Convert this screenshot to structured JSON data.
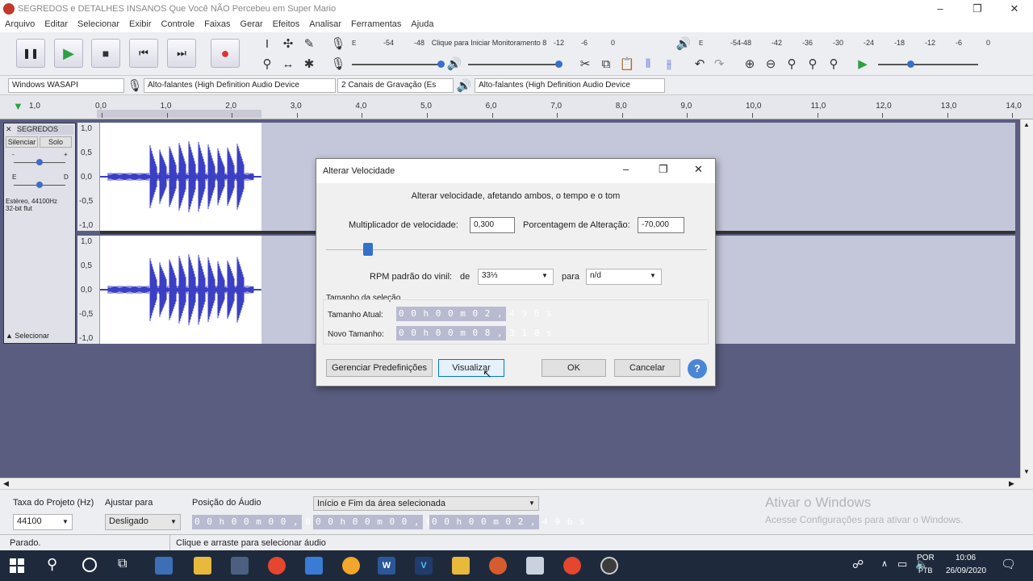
{
  "window": {
    "title": "SEGREDOS e DETALHES INSANOS Que Você NÃO Percebeu em Super Mario",
    "minimize": "–",
    "maximize": "❐",
    "close": "✕"
  },
  "menu": [
    "Arquivo",
    "Editar",
    "Selecionar",
    "Exibir",
    "Controle",
    "Faixas",
    "Gerar",
    "Efeitos",
    "Analisar",
    "Ferramentas",
    "Ajuda"
  ],
  "transport": {
    "pause": "❚❚",
    "play": "▶",
    "stop": "■",
    "skip_start": "⏮",
    "skip_end": "⏭",
    "record": "●"
  },
  "meter": {
    "record_scale": [
      "-54",
      "-48",
      "Clique para Iniciar Monitoramento 8",
      "-12",
      "-6",
      "0"
    ],
    "play_scale": [
      "-54",
      "-48",
      "-42",
      "-36",
      "-30",
      "-24",
      "-18",
      "-12",
      "-6",
      "0"
    ],
    "left_channel": "E",
    "right_channel": "D"
  },
  "devices": {
    "host": "Windows WASAPI",
    "recording_device": "Alto-falantes (High Definition Audio Device",
    "channels": "2 Canais de Gravação (Es",
    "playback_device": "Alto-falantes (High Definition Audio Device"
  },
  "timeline": {
    "ticks": [
      "0,0",
      "1,0",
      "2,0",
      "3,0",
      "4,0",
      "5,0",
      "6,0",
      "7,0",
      "8,0",
      "9,0",
      "10,0",
      "11,0",
      "12,0",
      "13,0",
      "14,0"
    ],
    "start_label": "1,0"
  },
  "track": {
    "name": "SEGREDOS",
    "mute": "Silenciar",
    "solo": "Solo",
    "gain_minus": "-",
    "gain_plus": "+",
    "pan_left": "E",
    "pan_right": "D",
    "info": "Estéreo, 44100Hz\n32-bit flut",
    "select": "Selecionar",
    "scale": [
      "1,0",
      "0,5",
      "0,0",
      "-0,5",
      "-1,0"
    ]
  },
  "dialog": {
    "title": "Alterar Velocidade",
    "description": "Alterar velocidade, afetando ambos, o tempo e o tom",
    "multiplier_label": "Multiplicador de velocidade:",
    "multiplier_value": "0,300",
    "percent_label": "Porcentagem de Alteração:",
    "percent_value": "-70,000",
    "slider_fraction": 0.11,
    "vinyl_label": "RPM padrão do vinil:",
    "from_label": "de",
    "from_value": "33⅓",
    "to_label": "para",
    "to_value": "n/d",
    "selection_group": "Tamanho da seleção",
    "current_label": "Tamanho Atual:",
    "current_value": "0 0 h 0 0 m 0 2 , 4 9 6 s",
    "new_label": "Novo Tamanho:",
    "new_value": "0 0 h 0 0 m 0 8 , 3 1 8 s",
    "presets_button": "Gerenciar Predefinições",
    "preview_button": "Visualizar",
    "ok_button": "OK",
    "cancel_button": "Cancelar",
    "help_button": "?"
  },
  "selection_toolbar": {
    "rate_label": "Taxa do Projeto (Hz)",
    "rate_value": "44100",
    "snap_label": "Ajustar para",
    "snap_value": "Desligado",
    "position_label": "Posição do Áudio",
    "position_value": "0 0 h 0 0 m 0 0 , 0 0 0 s",
    "range_label": "Início e Fim da área selecionada",
    "start_value": "0 0 h 0 0 m 0 0 , 0 0 0 s",
    "end_value": "0 0 h 0 0 m 0 2 , 4 9 6 s"
  },
  "status": {
    "state": "Parado.",
    "hint": "Clique e arraste para selecionar áudio"
  },
  "watermark": {
    "line1": "Ativar o Windows",
    "line2": "Acesse Configurações para ativar o Windows."
  },
  "taskbar": {
    "language": "POR",
    "layout": "PTB",
    "time": "10:06",
    "date": "26/09/2020"
  }
}
